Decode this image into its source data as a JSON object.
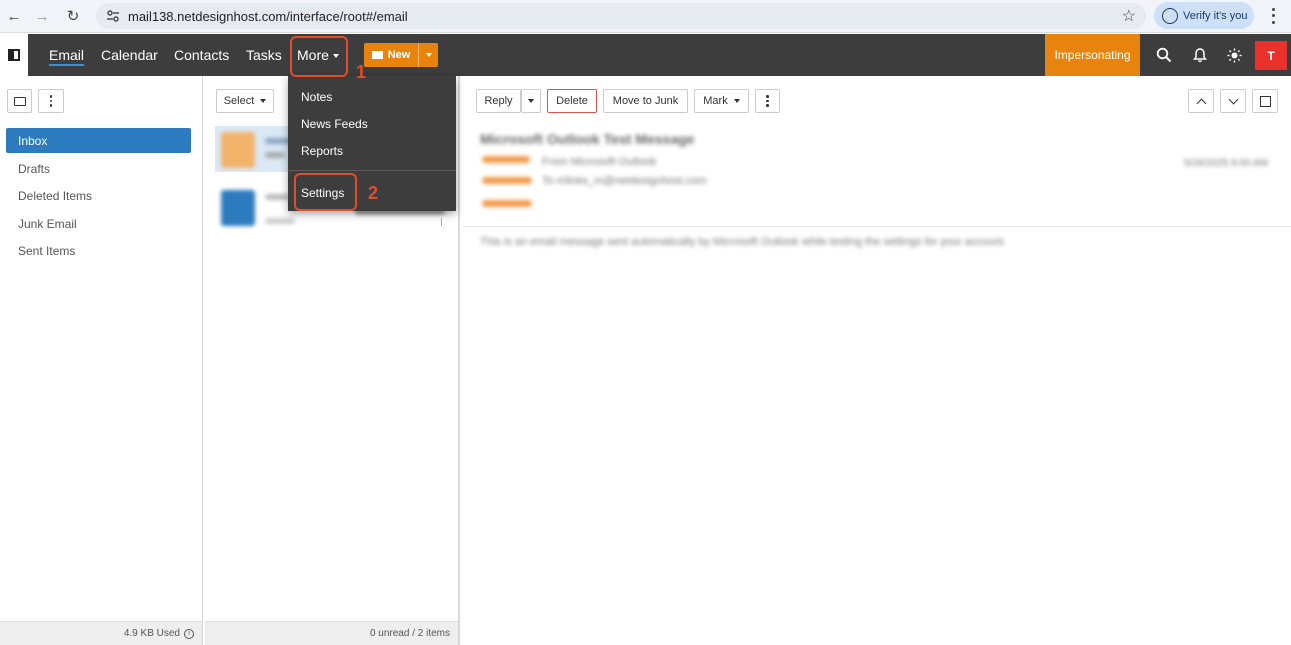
{
  "browser": {
    "url": "mail138.netdesignhost.com/interface/root#/email",
    "verify_label": "Verify it's you"
  },
  "nav": {
    "items": [
      "Email",
      "Calendar",
      "Contacts",
      "Tasks"
    ],
    "more_label": "More",
    "new_label": "New",
    "impersonating_label": "Impersonating",
    "avatar_initial": "T"
  },
  "more_menu": {
    "items": [
      "Notes",
      "News Feeds",
      "Reports"
    ],
    "settings_label": "Settings"
  },
  "annotations": {
    "step1": "1",
    "step2": "2"
  },
  "folders": {
    "items": [
      "Inbox",
      "Drafts",
      "Deleted Items",
      "Junk Email",
      "Sent Items"
    ],
    "active": "Inbox",
    "usage_label": "4.9 KB Used"
  },
  "message_list": {
    "select_label": "Select",
    "status_label": "0 unread / 2 items"
  },
  "reading_toolbar": {
    "reply_label": "Reply",
    "delete_label": "Delete",
    "move_to_junk_label": "Move to Junk",
    "mark_label": "Mark"
  },
  "reading": {
    "subject": "Microsoft Outlook Test Message",
    "from_line": "From Microsoft Outlook",
    "to_line": "To mlinks_m@netdesignhost.com",
    "date": "5/26/2025 8:00 AM",
    "body": "This is an email message sent automatically by Microsoft Outlook while testing the settings for your account."
  }
}
